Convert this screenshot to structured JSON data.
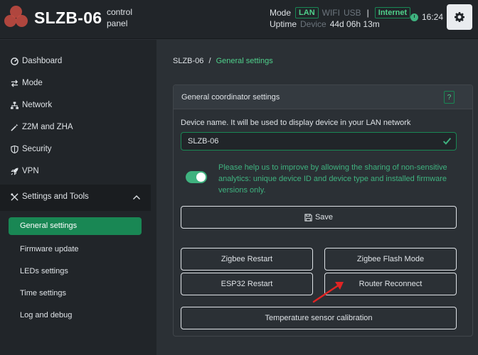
{
  "header": {
    "brand": "SLZB-06",
    "subtitle_line1": "control",
    "subtitle_line2": "panel",
    "mode_label": "Mode",
    "mode_lan": "LAN",
    "mode_wifi": "WIFI",
    "mode_usb": "USB",
    "separator": "|",
    "internet_badge": "Internet",
    "uptime_label": "Uptime",
    "device_label": "Device",
    "uptime_value": "44d 06h 13m",
    "time": "16:24"
  },
  "sidebar": {
    "items": [
      {
        "label": "Dashboard",
        "icon": "dashboard-icon"
      },
      {
        "label": "Mode",
        "icon": "arrows-icon"
      },
      {
        "label": "Network",
        "icon": "network-icon"
      },
      {
        "label": "Z2M and ZHA",
        "icon": "wand-icon"
      },
      {
        "label": "Security",
        "icon": "shield-icon"
      },
      {
        "label": "VPN",
        "icon": "rocket-icon"
      }
    ],
    "section": {
      "label": "Settings and Tools",
      "icon": "tools-icon"
    },
    "sub_items": [
      "General settings",
      "Firmware update",
      "LEDs settings",
      "Time settings",
      "Log and debug"
    ]
  },
  "breadcrumb": {
    "root": "SLZB-06",
    "separator": "/",
    "current": "General settings"
  },
  "card": {
    "title": "General coordinator settings",
    "help": "?",
    "device_name_label": "Device name. It will be used to display device in your LAN network",
    "device_name_value": "SLZB-06",
    "consent_text": "Please help us to improve by allowing the sharing of non-sensitive analytics: unique device ID and device type and installed firmware versions only.",
    "consent_enabled": true,
    "save_label": "Save",
    "buttons": {
      "zigbee_restart": "Zigbee Restart",
      "zigbee_flash": "Zigbee Flash Mode",
      "esp32_restart": "ESP32 Restart",
      "router_reconnect": "Router Reconnect",
      "temp_calibration": "Temperature sensor calibration"
    }
  },
  "colors": {
    "accent": "#198754",
    "accent_text": "#3fb27f",
    "annotation_arrow": "#e02424"
  }
}
